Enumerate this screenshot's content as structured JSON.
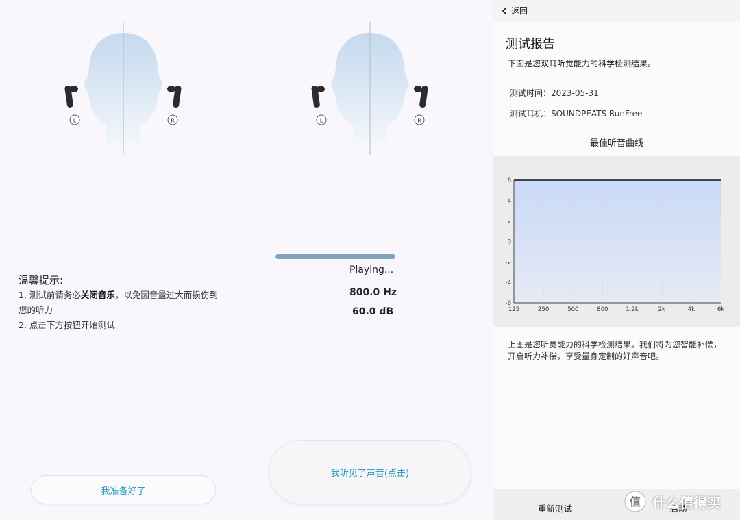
{
  "panel1": {
    "left_label": "L",
    "right_label": "R",
    "tips_title": "温馨提示:",
    "tip1_prefix": "1. 测试前请务必",
    "tip1_bold": "关闭音乐",
    "tip1_suffix": "，以免因音量过大而损伤到",
    "tip1_line2": "您的听力",
    "tip2": "2. 点击下方按钮开始测试",
    "ready_button": "我准备好了"
  },
  "panel2": {
    "left_label": "L",
    "right_label": "R",
    "progress": 0.5,
    "status": "Playing...",
    "frequency": "800.0 Hz",
    "level": "60.0 dB",
    "heard_button": "我听见了声音(点击)"
  },
  "panel3": {
    "back_label": "返回",
    "title": "测试报告",
    "subtitle": "下面是您双耳听觉能力的科学检测结果。",
    "test_time": "测试时间：2023-05-31",
    "test_device": "测试耳机：SOUNDPEATS RunFree",
    "curve_title": "最佳听音曲线",
    "description": "上图是您听觉能力的科学检测结果。我们将为您智能补偿，开启听力补偿，享受量身定制的好声音吧。",
    "retest_button": "重新测试",
    "enable_button": "启动",
    "watermark_text": "什么值得买",
    "watermark_logo": "值"
  },
  "chart_data": {
    "type": "area",
    "categories": [
      "125",
      "250",
      "500",
      "800",
      "1.2k",
      "2k",
      "4k",
      "6k"
    ],
    "values": [
      6,
      6,
      6,
      6,
      6,
      6,
      6,
      6
    ],
    "yticks": [
      "6",
      "4",
      "2",
      "0",
      "-2",
      "-4",
      "-6"
    ],
    "ylim": [
      -6,
      6
    ],
    "grid": true,
    "colors": {
      "fill_top": "#c9d9f7",
      "fill_bottom": "#e6eaf4",
      "line": "#111111"
    }
  }
}
